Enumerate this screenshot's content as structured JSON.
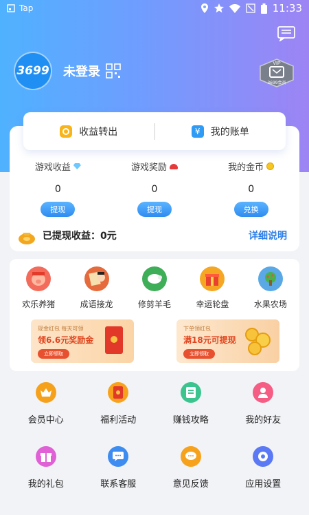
{
  "status_bar": {
    "app_label": "Tap",
    "time": "11:33"
  },
  "profile": {
    "avatar_text": "3699",
    "login_text": "未登录",
    "vip_label": "VIP",
    "vip_sub": "3699会员"
  },
  "top_card": {
    "transfer_label": "收益转出",
    "account_label": "我的账单"
  },
  "stats": [
    {
      "label": "游戏收益",
      "value": "0",
      "button": "提现",
      "icon": "gem-icon"
    },
    {
      "label": "游戏奖励",
      "value": "0",
      "button": "提现",
      "icon": "heart-icon"
    },
    {
      "label": "我的金币",
      "value": "0",
      "button": "兑换",
      "icon": "gold-coin-icon"
    }
  ],
  "withdrawn": {
    "text": "已提现收益：0元",
    "detail_link": "详细说明"
  },
  "games": [
    {
      "name": "欢乐养猪",
      "color": "#f36b5a"
    },
    {
      "name": "成语接龙",
      "color": "#e56a3c"
    },
    {
      "name": "修剪羊毛",
      "color": "#3fae58"
    },
    {
      "name": "幸运轮盘",
      "color": "#f5a623"
    },
    {
      "name": "水果农场",
      "color": "#5aa9e6"
    }
  ],
  "banners": [
    {
      "small": "现金红包 每天可领",
      "big": "领6.6元奖励金",
      "cta": "立即领取"
    },
    {
      "small": "下单领红包",
      "big": "满18元可提现",
      "cta": "立即领取"
    }
  ],
  "menu": [
    {
      "name": "会员中心",
      "color": "#f6a11b",
      "icon": "crown-icon"
    },
    {
      "name": "福利活动",
      "color": "#f8a21c",
      "icon": "gift-card-icon"
    },
    {
      "name": "赚钱攻略",
      "color": "#3cc48f",
      "icon": "book-icon"
    },
    {
      "name": "我的好友",
      "color": "#f55d84",
      "icon": "friend-icon"
    },
    {
      "name": "我的礼包",
      "color": "#e061d6",
      "icon": "giftbox-icon"
    },
    {
      "name": "联系客服",
      "color": "#3d8cf0",
      "icon": "chat-icon"
    },
    {
      "name": "意见反馈",
      "color": "#f7a21c",
      "icon": "feedback-icon"
    },
    {
      "name": "应用设置",
      "color": "#5b79f5",
      "icon": "settings-icon"
    }
  ]
}
